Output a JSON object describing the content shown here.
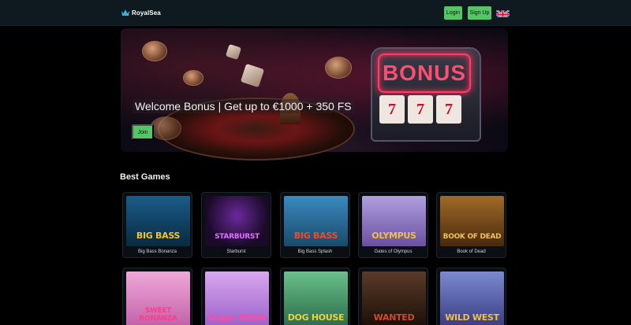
{
  "header": {
    "logo_text": "RoyalSea",
    "logo_icon": "crown-icon",
    "login_label": "Login",
    "signup_label": "Sign Up",
    "language_flag": "uk-flag-icon"
  },
  "hero": {
    "title": "Welcome Bonus | Get up to €1000 + 350 FS",
    "join_label": "Join",
    "sign_text": "BONUS",
    "reels": [
      "7",
      "7",
      "7"
    ]
  },
  "section": {
    "title": "Best Games"
  },
  "games_row1": [
    {
      "name": "Big Bass Bonanza",
      "thumb_text": "BIG BASS",
      "bg": "#1a5c8a",
      "accent": "#f2c230"
    },
    {
      "name": "Starburst",
      "thumb_text": "STARBURST",
      "bg": "#2a1040",
      "accent": "#e070ff"
    },
    {
      "name": "Big Bass Splash",
      "thumb_text": "BIG BASS",
      "bg": "#2f7aa8",
      "accent": "#f04a2a"
    },
    {
      "name": "Gates of Olympus",
      "thumb_text": "OLYMPUS",
      "bg": "#8a78c0",
      "accent": "#f2c040"
    },
    {
      "name": "Book of Dead",
      "thumb_text": "BOOK OF DEAD",
      "bg": "#7a4a1a",
      "accent": "#f0c060"
    }
  ],
  "games_row2": [
    {
      "thumb_text": "SWEET BONANZA",
      "bg": "#e890c8",
      "accent": "#ff3b8a"
    },
    {
      "thumb_text": "Sugar RUSH",
      "bg": "#c090e0",
      "accent": "#ff4aa0"
    },
    {
      "thumb_text": "DOG HOUSE",
      "bg": "#4a9a6a",
      "accent": "#f0d040"
    },
    {
      "thumb_text": "WANTED",
      "bg": "#3a2418",
      "accent": "#d04a2a"
    },
    {
      "thumb_text": "WILD WEST",
      "bg": "#5a6ab0",
      "accent": "#f0c040"
    }
  ]
}
